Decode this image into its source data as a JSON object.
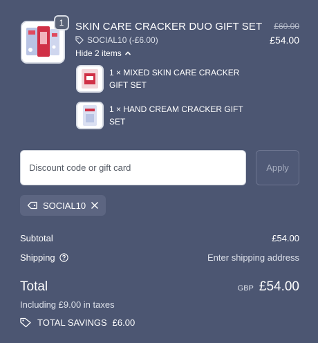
{
  "product": {
    "title": "SKIN CARE CRACKER DUO GIFT SET",
    "quantity": "1",
    "discount_text": "SOCIAL10 (-£6.00)",
    "hide_items_label": "Hide 2 items",
    "original_price": "£60.00",
    "price": "£54.00",
    "items": [
      {
        "line1": "1 × MIXED SKIN CARE CRACKER",
        "line2": "GIFT SET"
      },
      {
        "line1": "1 × HAND CREAM CRACKER GIFT",
        "line2": "SET"
      }
    ]
  },
  "discount": {
    "placeholder": "Discount code or gift card",
    "apply_label": "Apply",
    "applied_code": "SOCIAL10"
  },
  "summary": {
    "subtotal_label": "Subtotal",
    "subtotal_value": "£54.00",
    "shipping_label": "Shipping",
    "shipping_value": "Enter shipping address",
    "total_label": "Total",
    "currency": "GBP",
    "total_value": "£54.00",
    "taxes_text": "Including £9.00 in taxes",
    "savings_label": "TOTAL SAVINGS",
    "savings_value": "£6.00"
  },
  "colors": {
    "background": "#4c5672",
    "tag_background": "#5c6581",
    "text": "#ffffff",
    "muted_text": "#dde1ea"
  },
  "icons": [
    "tag-icon",
    "chevron-up-icon",
    "close-icon",
    "help-circle-icon",
    "savings-tag-icon"
  ]
}
